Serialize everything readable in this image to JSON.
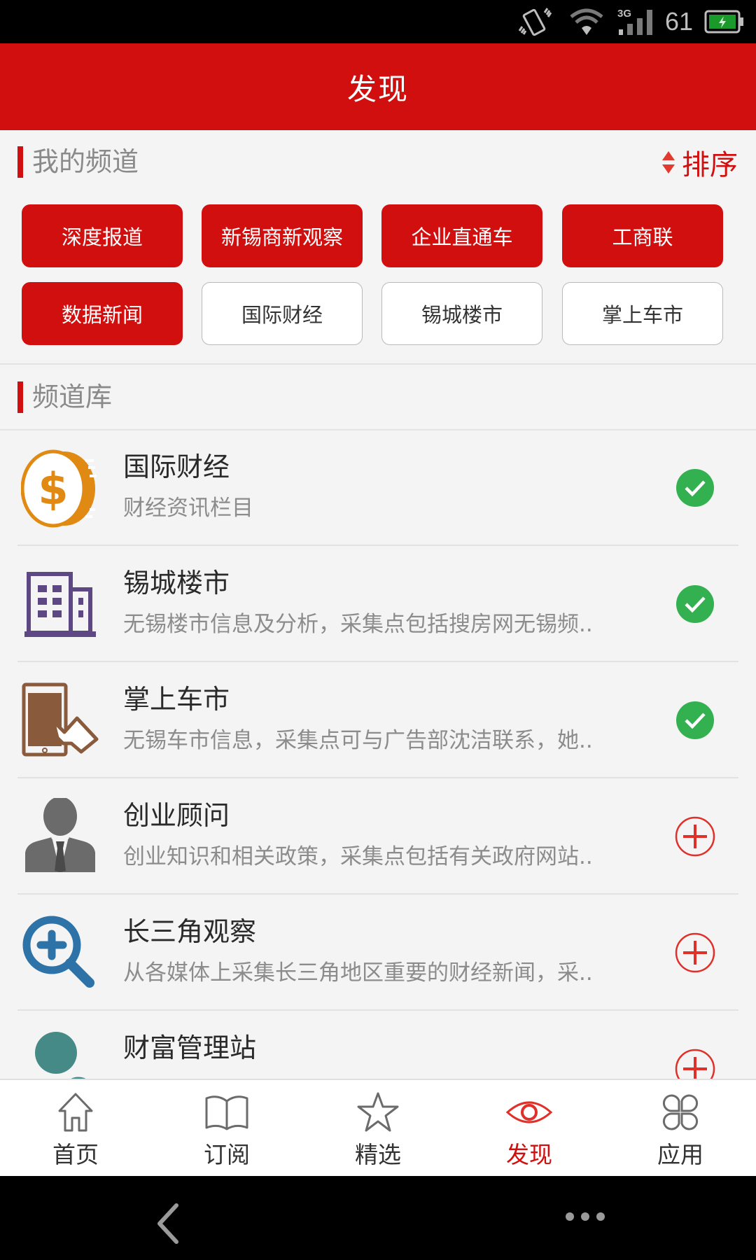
{
  "status_bar": {
    "battery_level": "61",
    "icons": [
      "vibrate-icon",
      "wifi-icon",
      "signal-3g-icon",
      "battery-charging-icon"
    ],
    "network_label": "3G"
  },
  "header": {
    "title": "发现"
  },
  "my_channels": {
    "title": "我的频道",
    "sort_label": "排序",
    "items": [
      {
        "label": "深度报道",
        "selected": true
      },
      {
        "label": "新锡商新观察",
        "selected": true
      },
      {
        "label": "企业直通车",
        "selected": true
      },
      {
        "label": "工商联",
        "selected": true
      },
      {
        "label": "数据新闻",
        "selected": true
      },
      {
        "label": "国际财经",
        "selected": false
      },
      {
        "label": "锡城楼市",
        "selected": false
      },
      {
        "label": "掌上车市",
        "selected": false
      }
    ]
  },
  "channel_library": {
    "title": "频道库",
    "items": [
      {
        "name": "国际财经",
        "desc": "财经资讯栏目",
        "icon": "coin-dollar-icon",
        "subscribed": true
      },
      {
        "name": "锡城楼市",
        "desc": "无锡楼市信息及分析，采集点包括搜房网无锡频..",
        "icon": "building-icon",
        "subscribed": true
      },
      {
        "name": "掌上车市",
        "desc": "无锡车市信息，采集点可与广告部沈洁联系，她..",
        "icon": "phone-touch-icon",
        "subscribed": true
      },
      {
        "name": "创业顾问",
        "desc": "创业知识和相关政策，采集点包括有关政府网站..",
        "icon": "businessman-icon",
        "subscribed": false
      },
      {
        "name": "长三角观察",
        "desc": "从各媒体上采集长三角地区重要的财经新闻，采..",
        "icon": "zoom-in-icon",
        "subscribed": false
      },
      {
        "name": "财富管理站",
        "desc": "",
        "icon": "user-remove-icon",
        "subscribed": false
      }
    ]
  },
  "bottom_nav": {
    "items": [
      {
        "label": "首页",
        "icon": "home-icon",
        "active": false
      },
      {
        "label": "订阅",
        "icon": "book-icon",
        "active": false
      },
      {
        "label": "精选",
        "icon": "star-icon",
        "active": false
      },
      {
        "label": "发现",
        "icon": "eye-icon",
        "active": true
      },
      {
        "label": "应用",
        "icon": "apps-icon",
        "active": false
      }
    ]
  },
  "colors": {
    "brand_red": "#d10f0f",
    "check_green": "#33b150",
    "add_red": "#e0302a"
  }
}
